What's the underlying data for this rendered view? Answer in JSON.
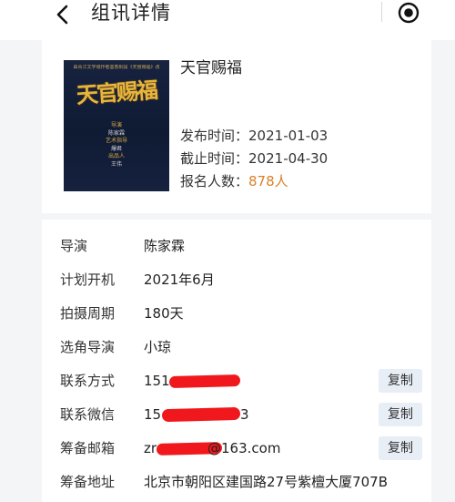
{
  "header": {
    "title": "组讯详情",
    "back_icon": "back-arrow-icon",
    "more_icon": "more-dots-icon",
    "close_icon": "target-close-icon"
  },
  "summary": {
    "poster": {
      "top_text": "由青江文学城作者墨香铜臭《天官赐福》改",
      "title": "天官赐福",
      "credits": [
        {
          "role": "导演",
          "name": "陈家霖"
        },
        {
          "role": "艺术指导",
          "name": "爆君"
        },
        {
          "role": "出品人",
          "name": "王伟"
        }
      ]
    },
    "project_name": "天官赐福",
    "publish": {
      "label": "发布时间：",
      "value": "2021-01-03"
    },
    "deadline": {
      "label": "截止时间：",
      "value": "2021-04-30"
    },
    "signups": {
      "label": "报名人数：",
      "value": "878人"
    },
    "accent_color": "#d9822b"
  },
  "details": {
    "director": {
      "label": "导演",
      "value": "陈家霖"
    },
    "plan_start": {
      "label": "计划开机",
      "value": "2021年6月"
    },
    "shoot_period": {
      "label": "拍摄周期",
      "value": "180天"
    },
    "casting_director": {
      "label": "选角导演",
      "value": "小琼"
    },
    "contact": {
      "label": "联系方式",
      "value": "151",
      "copy_label": "复制"
    },
    "wechat": {
      "label": "联系微信",
      "value": "15",
      "value_tail": "3",
      "copy_label": "复制"
    },
    "email": {
      "label": "筹备邮箱",
      "value": "zr",
      "value_tail": "@163.com",
      "copy_label": "复制"
    },
    "address": {
      "label": "筹备地址",
      "value": "北京市朝阳区建国路27号紫檀大厦707B"
    }
  }
}
